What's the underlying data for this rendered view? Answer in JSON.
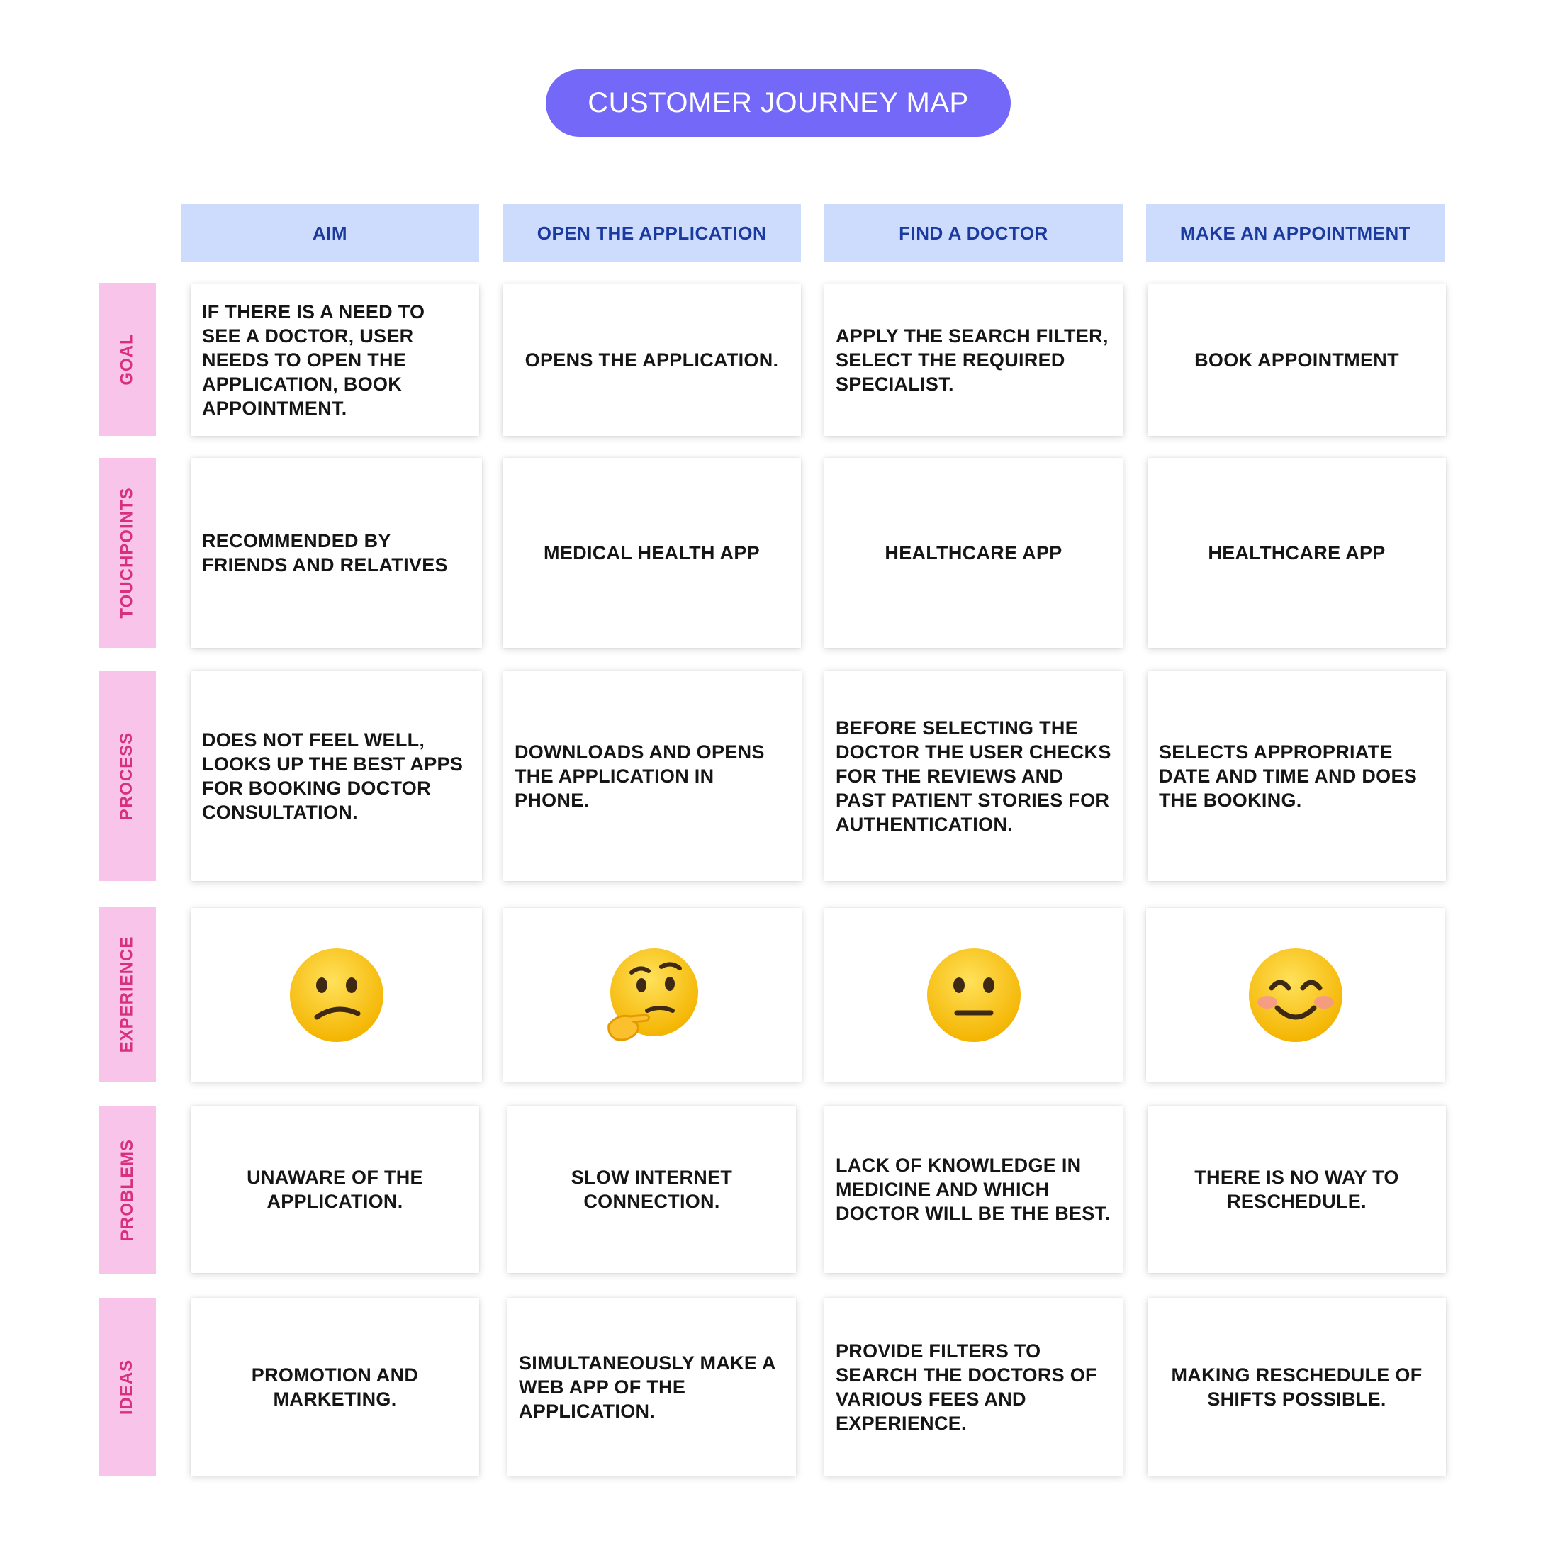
{
  "title": "CUSTOMER JOURNEY MAP",
  "columns": [
    "AIM",
    "OPEN THE APPLICATION",
    "FIND A DOCTOR",
    "MAKE AN APPOINTMENT"
  ],
  "rows": [
    "GOAL",
    "TOUCHPOINTS",
    "PROCESS",
    "EXPERIENCE",
    "PROBLEMS",
    "IDEAS"
  ],
  "colors": {
    "title_bg": "#7468f9",
    "header_bg": "#cddcfd",
    "header_text": "#1b3aa0",
    "row_label_bg": "#f9c4ea",
    "row_label_text": "#d9307e"
  },
  "cells": {
    "goal": [
      "IF THERE IS A NEED TO SEE A DOCTOR, USER NEEDS TO OPEN THE APPLICATION, BOOK APPOINTMENT.",
      "OPENS THE APPLICATION.",
      "APPLY THE SEARCH FILTER, SELECT THE REQUIRED SPECIALIST.",
      "BOOK APPOINTMENT"
    ],
    "touchpoints": [
      "RECOMMENDED BY FRIENDS AND RELATIVES",
      "MEDICAL HEALTH APP",
      "HEALTHCARE APP",
      "HEALTHCARE APP"
    ],
    "process": [
      "DOES NOT FEEL WELL, LOOKS UP THE BEST APPS FOR BOOKING DOCTOR CONSULTATION.",
      "DOWNLOADS AND OPENS THE APPLICATION IN PHONE.",
      "BEFORE SELECTING THE DOCTOR THE USER CHECKS FOR THE REVIEWS AND PAST PATIENT STORIES FOR AUTHENTICATION.",
      "SELECTS APPROPRIATE DATE AND TIME AND DOES THE BOOKING."
    ],
    "experience": [
      "confused-face-icon",
      "thinking-face-icon",
      "neutral-face-icon",
      "smiling-face-icon"
    ],
    "problems": [
      "UNAWARE OF THE APPLICATION.",
      "SLOW INTERNET CONNECTION.",
      "LACK OF KNOWLEDGE IN MEDICINE AND WHICH DOCTOR WILL BE THE BEST.",
      "THERE IS NO WAY TO RESCHEDULE."
    ],
    "ideas": [
      "PROMOTION AND MARKETING.",
      "SIMULTANEOUSLY MAKE A WEB APP OF THE APPLICATION.",
      "PROVIDE FILTERS TO SEARCH THE DOCTORS OF VARIOUS FEES AND EXPERIENCE.",
      "MAKING RESCHEDULE OF SHIFTS POSSIBLE."
    ]
  }
}
